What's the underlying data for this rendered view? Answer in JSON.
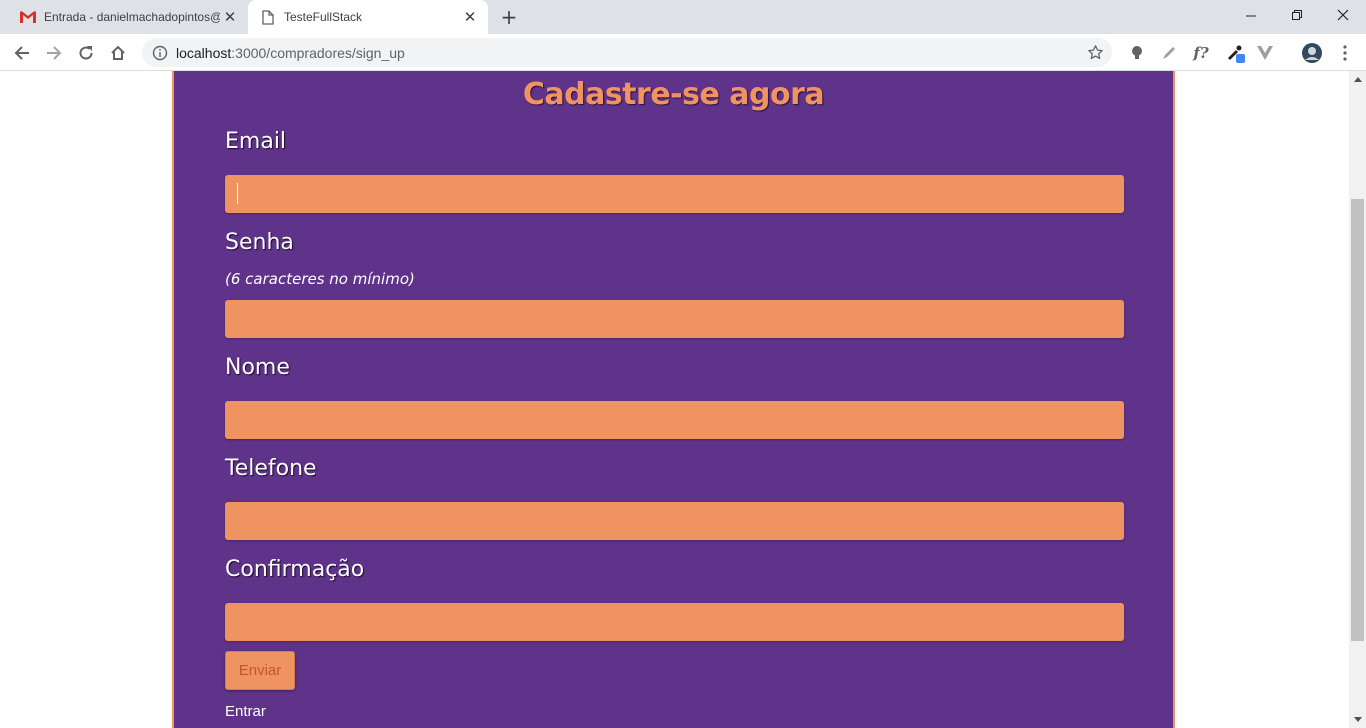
{
  "browser": {
    "tabs": [
      {
        "title": "Entrada - danielmachadopintos@",
        "favicon": "gmail-icon"
      },
      {
        "title": "TesteFullStack",
        "favicon": "page-icon"
      }
    ],
    "url_host": "localhost",
    "url_path": ":3000/compradores/sign_up"
  },
  "form": {
    "heading": "Cadastre-se agora",
    "email_label": "Email",
    "email_value": "",
    "senha_label": "Senha",
    "senha_hint": "(6 caracteres no mínimo)",
    "senha_value": "",
    "nome_label": "Nome",
    "nome_value": "",
    "telefone_label": "Telefone",
    "telefone_value": "",
    "confirmacao_label": "Confirmação",
    "confirmacao_value": "",
    "submit_label": "Enviar",
    "login_link": "Entrar"
  },
  "colors": {
    "panel": "#5f3389",
    "accent": "#ef9361"
  }
}
